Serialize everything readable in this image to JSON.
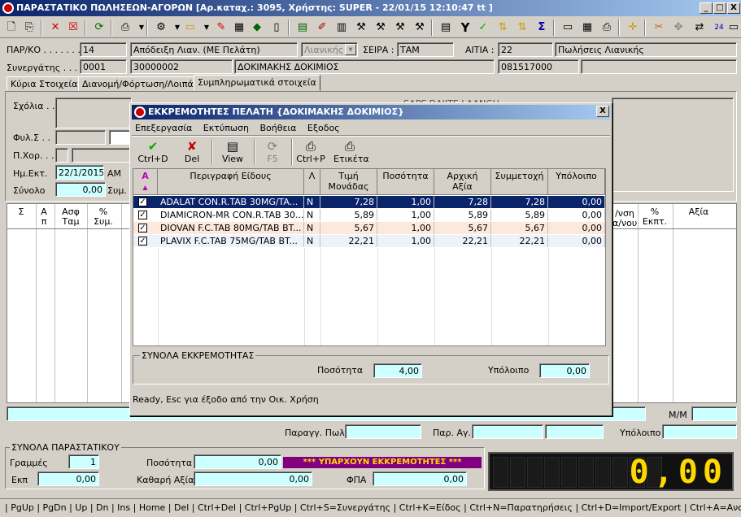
{
  "window": {
    "title": "ΠΑΡΑΣΤΑΤΙΚΟ ΠΩΛΗΣΕΩΝ-ΑΓΟΡΩΝ [Αρ.καταχ.: 3095, Χρήστης: SUPER - 22/01/15 12:10:47 tt ]",
    "min": "_",
    "max": "□",
    "close": "X"
  },
  "header": {
    "par_label": "ΠΑΡ/ΚΟ . . . . . . .",
    "par_code": "14",
    "par_desc": "Απόδειξη Λιαν. (ΜΕ Πελάτη)",
    "par_type": "Λιανικής",
    "seira_label": "ΣΕΙΡΑ :",
    "seira_value": "ΤΑΜ",
    "aitia_label": "ΑΙΤΙΑ :",
    "aitia_code": "22",
    "aitia_desc": "Πωλήσεις Λιανικής",
    "syn_label": "Συνεργάτης . . .",
    "syn_code": "0001",
    "syn_num": "30000002",
    "syn_name": "ΔΟΚΙΜΑΚΗΣ ΔΟΚΙΜΙΟΣ",
    "syn_afm": "081517000"
  },
  "tabs": [
    "Κύρια Στοιχεία",
    "Διανομή/Φόρτωση/Λοιπά",
    "Συμπληρωματικά στοιχεία"
  ],
  "left_form": {
    "sxolia": "Σχόλια . .",
    "fyl": "Φυλ.Σ . .",
    "pxor": "Π.Χορ. . .",
    "hmekt": "Ημ.Εκτ.",
    "hmekt_value": "22/1/2015",
    "am": "ΑΜ",
    "synolo": "Σύνολο",
    "synolo_value": "0,00",
    "sym": "Συμ.",
    "bg_text": "SAPE DAJITE LAANGU"
  },
  "main_grid": {
    "headers": [
      "Σ",
      "Α\nπ",
      "Ασφ\nΤαμ",
      "%\nΣυμ."
    ],
    "right_headers": [
      "/νση\nα/νου",
      "%\nΕκπτ.",
      "Αξία"
    ]
  },
  "dialog": {
    "title": "ΕΚΚΡΕΜΟΤΗΤΕΣ ΠΕΛΑΤΗ {ΔΟΚΙΜΑΚΗΣ ΔΟΚΙΜΙΟΣ}",
    "close": "X",
    "menu": [
      "Επεξεργασία",
      "Εκτύπωση",
      "Βοήθεια",
      "Εξοδος"
    ],
    "buttons": [
      {
        "label": "Ctrl+D",
        "icon": "✔"
      },
      {
        "label": "Del",
        "icon": "✘"
      },
      {
        "label": "View",
        "icon": "▤"
      },
      {
        "label": "F5",
        "icon": "⟳"
      },
      {
        "label": "Ctrl+P",
        "icon": "⎙"
      },
      {
        "label": "Ετικέτα",
        "icon": "⎙"
      }
    ],
    "columns": [
      "Περιγραφή Είδους",
      "Λ",
      "Τιμή\nΜονάδας",
      "Ποσότητα",
      "Αρχική\nΑξία",
      "Συμμετοχή",
      "Υπόλοιπο"
    ],
    "sort_mark": "A",
    "rows": [
      {
        "desc": "ADALAT CON.R.TAB 30MG/TA...",
        "l": "N",
        "price": "7,28",
        "qty": "1,00",
        "initial": "7,28",
        "share": "7,28",
        "rest": "0,00"
      },
      {
        "desc": "DIAMICRON-MR CON.R.TAB 30...",
        "l": "N",
        "price": "5,89",
        "qty": "1,00",
        "initial": "5,89",
        "share": "5,89",
        "rest": "0,00"
      },
      {
        "desc": "DIOVAN F.C.TAB 80MG/TAB BT...",
        "l": "N",
        "price": "5,67",
        "qty": "1,00",
        "initial": "5,67",
        "share": "5,67",
        "rest": "0,00"
      },
      {
        "desc": "PLAVIX F.C.TAB 75MG/TAB BT...",
        "l": "N",
        "price": "22,21",
        "qty": "1,00",
        "initial": "22,21",
        "share": "22,21",
        "rest": "0,00"
      }
    ],
    "totals_title": "ΣΥΝΟΛΑ ΕΚΚΡΕΜΟΤΗΤΑΣ",
    "qty_label": "Ποσότητα",
    "qty_value": "4,00",
    "rest_label": "Υπόλοιπο",
    "rest_value": "0,00",
    "status": "Ready, Esc για έξοδο από την Οικ. Χρήση"
  },
  "mid_row": {
    "mm": "Μ/Μ",
    "paragg": "Παραγγ. Πωλ.",
    "par_ag": "Παρ. Αγ.",
    "ypoloipo": "Υπόλοιπο"
  },
  "totals": {
    "title": "ΣΥΝΟΛΑ ΠΑΡΑΣΤΑΤΙΚΟΥ",
    "grammes_label": "Γραμμές",
    "grammes_value": "1",
    "posotita_label": "Ποσότητα",
    "posotita_value": "0,00",
    "alert": "*** ΥΠΑΡΧΟΥΝ ΕΚΚΡΕΜΟΤΗΤΕΣ ***",
    "ekp_label": "Εκπ",
    "ekp_value": "0,00",
    "kathari_label": "Καθαρή Αξία",
    "kathari_value": "0,00",
    "fpa_label": "ΦΠΑ",
    "fpa_value": "0,00",
    "display": "0,00"
  },
  "statusbar": "| PgUp | PgDn | Up | Dn | Ins | Home | Del | Ctrl+Del | Ctrl+PgUp | Ctrl+S=Συνεργάτης | Ctrl+K=Είδος | Ctrl+N=Παρατηρήσεις | Ctrl+D=Import/Export | Ctrl+A=Αναπροσαρμογή | Ctrl·",
  "colors": {
    "title_bg": "#0a246a",
    "selected_row": "#0a246a",
    "cyan_field": "#ccffff",
    "alert_bg": "#800080",
    "alert_fg": "#ffd800",
    "lcd_fg": "#ffd800"
  }
}
